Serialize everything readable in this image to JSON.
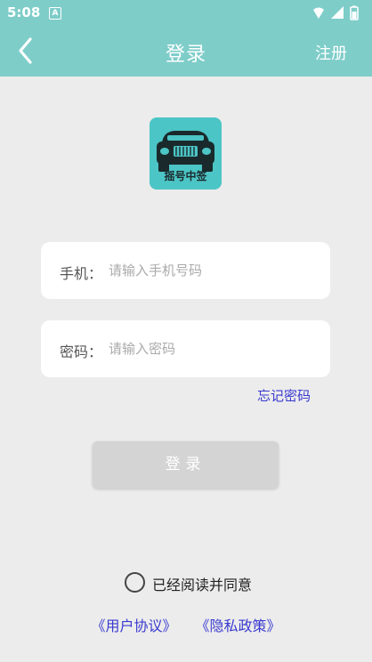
{
  "status_bar": {
    "time": "5:08",
    "notification_badge": "A"
  },
  "header": {
    "title": "登录",
    "register_label": "注册"
  },
  "logo": {
    "text": "摇号中签",
    "background": "#4cc5c6"
  },
  "form": {
    "phone_label": "手机：",
    "phone_placeholder": "请输入手机号码",
    "password_label": "密码：",
    "password_placeholder": "请输入密码",
    "forgot_label": "忘记密码"
  },
  "login_button_label": "登录",
  "agreement": {
    "text": "已经阅读并同意",
    "checked": false,
    "user_agreement": "《用户协议》",
    "privacy_policy": "《隐私政策》"
  },
  "colors": {
    "header": "#7ecdc9",
    "link": "#3a3ad0",
    "background": "#ececec"
  }
}
